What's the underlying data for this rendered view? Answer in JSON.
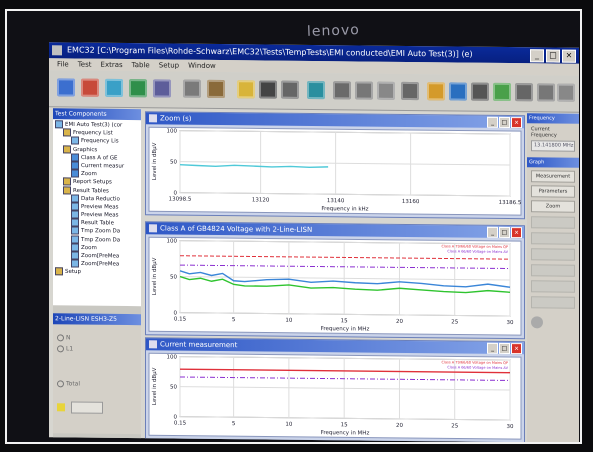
{
  "monitor": {
    "brand": "lenovo"
  },
  "window": {
    "title": "EMC32 [C:\\Program Files\\Rohde-Schwarz\\EMC32\\Tests\\TempTests\\EMI conducted\\EMI Auto Test(3)] (e)"
  },
  "menu": [
    "File",
    "Test",
    "Extras",
    "Table",
    "Setup",
    "Window"
  ],
  "toolbar_icons": [
    "open-icon",
    "report-icon",
    "graphics-icon",
    "settings-icon",
    "table-icon",
    "measure-icon",
    "tool-icon",
    "folder-icon",
    "save-icon",
    "print-icon",
    "exit-icon",
    "cursor-icon",
    "marker-icon",
    "marker2-icon",
    "marker3-icon",
    "limit-icon",
    "peak-icon",
    "zoom-icon",
    "export-icon",
    "prescan-icon",
    "final-icon",
    "stop-icon"
  ],
  "left_panel": {
    "title": "Test Components",
    "tree": [
      {
        "label": "EMI Auto Test(3) (cor",
        "indent": 0,
        "icon": "book"
      },
      {
        "label": "Frequency List",
        "indent": 1,
        "icon": "folder"
      },
      {
        "label": "Frequency Lis",
        "indent": 2,
        "icon": "book"
      },
      {
        "label": "Graphics",
        "indent": 1,
        "icon": "folder"
      },
      {
        "label": "Class A of  GE",
        "indent": 2,
        "icon": "chk"
      },
      {
        "label": "Current measur",
        "indent": 2,
        "icon": "chk"
      },
      {
        "label": "Zoom",
        "indent": 2,
        "icon": "chk"
      },
      {
        "label": "Report Setups",
        "indent": 1,
        "icon": "folder"
      },
      {
        "label": "Result Tables",
        "indent": 1,
        "icon": "folder"
      },
      {
        "label": "Data Reductio",
        "indent": 2,
        "icon": "book"
      },
      {
        "label": "Preview Meas",
        "indent": 2,
        "icon": "book"
      },
      {
        "label": "Preview Meas",
        "indent": 2,
        "icon": "book"
      },
      {
        "label": "Result Table",
        "indent": 2,
        "icon": "book"
      },
      {
        "label": "Tmp Zoom Da",
        "indent": 2,
        "icon": "book"
      },
      {
        "label": "Tmp Zoom Da",
        "indent": 2,
        "icon": "book"
      },
      {
        "label": "Zoom",
        "indent": 2,
        "icon": "book"
      },
      {
        "label": "Zoom[PreMea",
        "indent": 2,
        "icon": "book"
      },
      {
        "label": "Zoom[PreMea",
        "indent": 2,
        "icon": "book"
      },
      {
        "label": "Setup",
        "indent": 0,
        "icon": "folder"
      }
    ]
  },
  "lisn_panel": {
    "title": "2-Line-LISN ESH3-Z5",
    "options": [
      "N",
      "L1",
      "Total"
    ]
  },
  "right_panel": {
    "title": "Frequency",
    "current_frequency_label": "Current Frequency",
    "current_frequency_value": "13.141800 MHz",
    "section_title": "Graph",
    "buttons": [
      "Measurement",
      "Parameters",
      "Zoom"
    ]
  },
  "colors": {
    "green_trace": "#2fc42f",
    "blue_trace": "#3b86d8",
    "cyan_trace": "#4fc9d8",
    "red_limit": "#e0303a",
    "magenta_limit": "#8a2fd0"
  },
  "chart_data": [
    {
      "type": "line",
      "window_title": "Zoom (s)",
      "xlabel": "Frequency in kHz",
      "ylabel": "Level in dBµV",
      "ylim": [
        0,
        100
      ],
      "yticks": [
        "0",
        "50",
        "100"
      ],
      "xticks": [
        "13098.5",
        "13120",
        "13140",
        "13160",
        "13186.5"
      ],
      "x_values": [
        13098.5,
        13120,
        13140,
        13160,
        13186.5
      ],
      "series": [
        {
          "color": "#4fc9d8",
          "x": [
            13098.5,
            13103,
            13108,
            13113,
            13118,
            13123,
            13128,
            13133,
            13138
          ],
          "y": [
            45,
            44,
            43,
            45,
            44,
            43,
            44,
            43,
            44
          ]
        }
      ]
    },
    {
      "type": "line",
      "window_title": "Class A of  GB4824  Voltage with 2-Line-LISN",
      "xlabel": "Frequency in MHz",
      "ylabel": "Level in dBµV",
      "ylim": [
        0,
        100
      ],
      "yticks": [
        "0",
        "50",
        "100"
      ],
      "xticks": [
        "0.15",
        "5",
        "10",
        "15",
        "20",
        "25",
        "30"
      ],
      "x_values": [
        0.15,
        5,
        10,
        15,
        20,
        25,
        30
      ],
      "limit_labels": [
        "Class A 79/66/60 Voltage on Mains QP",
        "Class A 66/60 Voltage on Mains AV"
      ],
      "series": [
        {
          "color": "#e0303a",
          "style": "dash",
          "x": [
            0.15,
            30
          ],
          "y": [
            79,
            79
          ]
        },
        {
          "color": "#8a2fd0",
          "style": "dashdot",
          "x": [
            0.15,
            30
          ],
          "y": [
            66,
            66
          ]
        },
        {
          "color": "#3b86d8",
          "x": [
            0.15,
            1,
            2,
            3,
            4,
            5,
            6,
            8,
            10,
            12,
            14,
            16,
            18,
            20,
            22,
            24,
            26,
            28,
            30
          ],
          "y": [
            58,
            54,
            56,
            52,
            55,
            45,
            44,
            47,
            48,
            44,
            46,
            44,
            43,
            46,
            44,
            41,
            40,
            44,
            40
          ]
        },
        {
          "color": "#2fc42f",
          "x": [
            0.15,
            1,
            2,
            3,
            4,
            5,
            6,
            8,
            10,
            12,
            14,
            16,
            18,
            20,
            22,
            24,
            26,
            28,
            30
          ],
          "y": [
            50,
            46,
            48,
            44,
            47,
            40,
            38,
            38,
            40,
            36,
            37,
            35,
            34,
            37,
            35,
            33,
            32,
            35,
            33
          ]
        }
      ]
    },
    {
      "type": "line",
      "window_title": "Current measurement",
      "xlabel": "Frequency in MHz",
      "ylabel": "Level in dBµV",
      "ylim": [
        0,
        100
      ],
      "yticks": [
        "0",
        "50",
        "100"
      ],
      "xticks": [
        "0.15",
        "5",
        "10",
        "15",
        "20",
        "25",
        "30"
      ],
      "x_values": [
        0.15,
        5,
        10,
        15,
        20,
        25,
        30
      ],
      "limit_labels": [
        "Class A 79/66/60 Voltage on Mains QP",
        "Class A 66/60 Voltage on Mains AV"
      ],
      "series": [
        {
          "color": "#e0303a",
          "x": [
            0.15,
            30
          ],
          "y": [
            79,
            79
          ]
        },
        {
          "color": "#8a2fd0",
          "style": "dashdot",
          "x": [
            0.15,
            30
          ],
          "y": [
            66,
            66
          ]
        }
      ]
    }
  ]
}
